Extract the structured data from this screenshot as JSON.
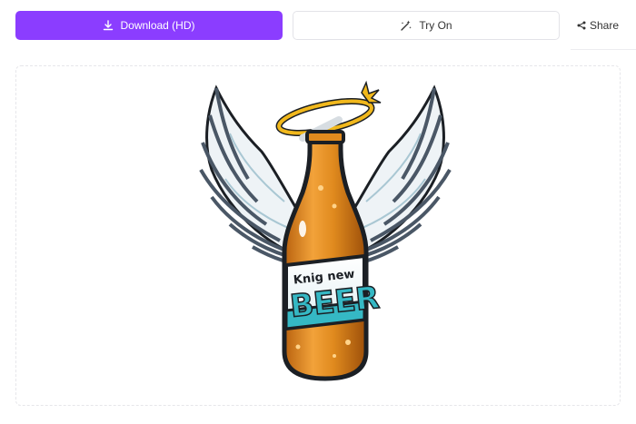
{
  "toolbar": {
    "download_label": "Download (HD)",
    "tryon_label": "Try On",
    "share_label": "Share",
    "download_icon": "download-icon",
    "tryon_icon": "magic-wand-icon",
    "share_icon": "share-icon",
    "accent_color": "#8b3dff"
  },
  "artwork": {
    "subject": "Winged beer bottle with halo illustration",
    "label_small": "Knig new",
    "label_big": "BEER",
    "colors": {
      "bottle": "#e08a1e",
      "label_teal": "#35b8c4",
      "halo": "#f1b81c",
      "wings": "#4a5766"
    }
  }
}
